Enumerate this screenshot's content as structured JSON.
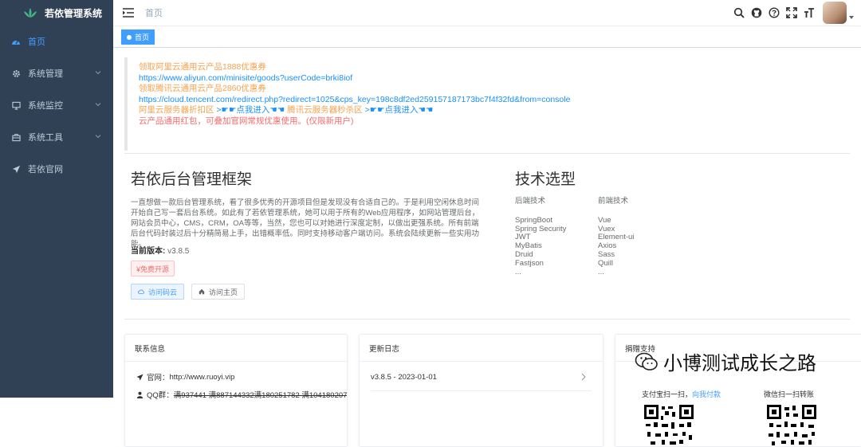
{
  "app": {
    "title": "若依管理系统"
  },
  "sidebar": {
    "items": [
      {
        "label": "首页",
        "icon": "dashboard-icon",
        "active": true,
        "has_children": false
      },
      {
        "label": "系统管理",
        "icon": "gear-icon",
        "active": false,
        "has_children": true
      },
      {
        "label": "系统监控",
        "icon": "monitor-icon",
        "active": false,
        "has_children": true
      },
      {
        "label": "系统工具",
        "icon": "toolbox-icon",
        "active": false,
        "has_children": true
      },
      {
        "label": "若依官网",
        "icon": "paper-plane-icon",
        "active": false,
        "has_children": false
      }
    ]
  },
  "navbar": {
    "breadcrumb": "首页",
    "icons": [
      "search-icon",
      "github-icon",
      "question-icon",
      "fullscreen-icon",
      "font-size-icon"
    ]
  },
  "tags": {
    "active": "首页"
  },
  "notice": {
    "line1": "领取阿里云通用云产品1888优惠券",
    "line2": "https://www.aliyun.com/minisite/goods?userCode=brki8iof",
    "line3": "领取腾讯云通用云产品2860优惠券",
    "line4": "https://cloud.tencent.com/redirect.php?redirect=1025&cps_key=198c8df2ed259157187173bc7f4f32fd&from=console",
    "line5a": "阿里云服务器折扣区",
    "line5b": ">☛☛点我进入☚☚",
    "line5c": "腾讯云服务器秒杀区",
    "line5d": ">☛☛点我进入☚☚",
    "line6": "云产品通用红包，可叠加官网常规优惠使用。(仅限新用户)"
  },
  "intro": {
    "title": "若依后台管理框架",
    "paragraph": "一直想做一款后台管理系统，看了很多优秀的开源项目但是发现没有合适自己的。于是利用空闲休息时间开始自己写一套后台系统。如此有了若依管理系统，她可以用于所有的Web应用程序，如网站管理后台，网站会员中心，CMS，CRM，OA等等，当然，您也可以对她进行深度定制，以做出更强系统。所有前端后台代码封装过后十分精简易上手，出错概率低。同时支持移动客户端访问。系统会陆续更新一些实用功能。",
    "version_label": "当前版本:",
    "version": "v3.8.5",
    "free_tag": "¥免费开源",
    "btn_gitee": "访问码云",
    "btn_home": "访问主页"
  },
  "tech": {
    "title": "技术选型",
    "backend_header": "后端技术",
    "frontend_header": "前端技术",
    "backend": [
      "SpringBoot",
      "Spring Security",
      "JWT",
      "MyBatis",
      "Druid",
      "Fastjson",
      "..."
    ],
    "frontend": [
      "Vue",
      "Vuex",
      "Element-ui",
      "Axios",
      "Sass",
      "Quill",
      "..."
    ]
  },
  "contact": {
    "title": "联系信息",
    "site_label": "官网：",
    "site": "http://www.ruoyi.vip",
    "qq_label": "QQ群：",
    "qq_groups": "满937441 满887144332满180251782 满104180207"
  },
  "changelog": {
    "title": "更新日志",
    "first": "v3.8.5 - 2023-01-01"
  },
  "donate": {
    "title_partial": "捐赠支持",
    "alipay_caption": "支付宝扫一扫，",
    "alipay_link": "向我付款",
    "wechat_caption": "微信扫一扫转账"
  },
  "watermark": {
    "text": "小博测试成长之路"
  },
  "colors": {
    "sidebar": "#304156",
    "accent": "#409eff",
    "orange": "#f7a34f",
    "red": "#f56c6c"
  }
}
